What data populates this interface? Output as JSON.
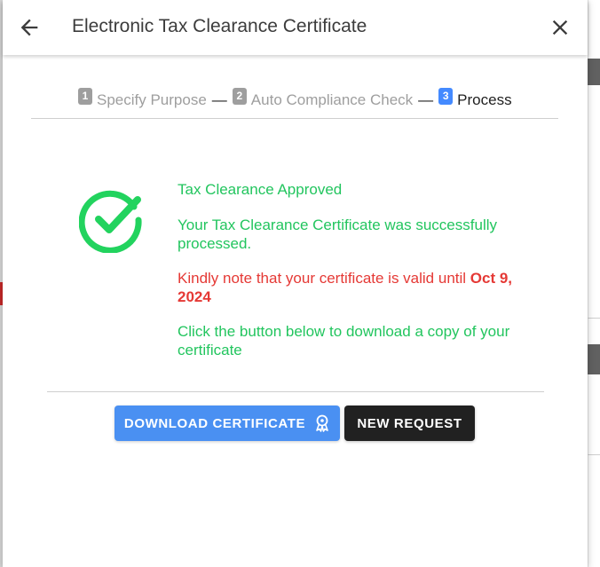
{
  "header": {
    "title": "Electronic Tax Clearance Certificate",
    "back_icon": "arrow-left-icon",
    "close_icon": "close-icon"
  },
  "stepper": {
    "steps": [
      {
        "number": "1",
        "label": "Specify Purpose",
        "active": false
      },
      {
        "number": "2",
        "label": "Auto Compliance Check",
        "active": false
      },
      {
        "number": "3",
        "label": "Process",
        "active": true
      }
    ],
    "separator": "—"
  },
  "result": {
    "icon": "check-circle-icon",
    "title": "Tax Clearance Approved",
    "message": "Your Tax Clearance Certificate was successfully processed.",
    "validity_prefix": "Kindly note that your certificate is valid until ",
    "validity_date": "Oct 9, 2024",
    "download_hint": "Click the button below to download a copy of your certificate"
  },
  "actions": {
    "download_label": "DOWNLOAD CERTIFICATE",
    "download_icon": "award-icon",
    "new_request_label": "NEW REQUEST"
  },
  "colors": {
    "success": "#22c55e",
    "warning": "#e53935",
    "primary": "#4a90f2",
    "dark": "#212121",
    "active_step": "#448aff"
  }
}
